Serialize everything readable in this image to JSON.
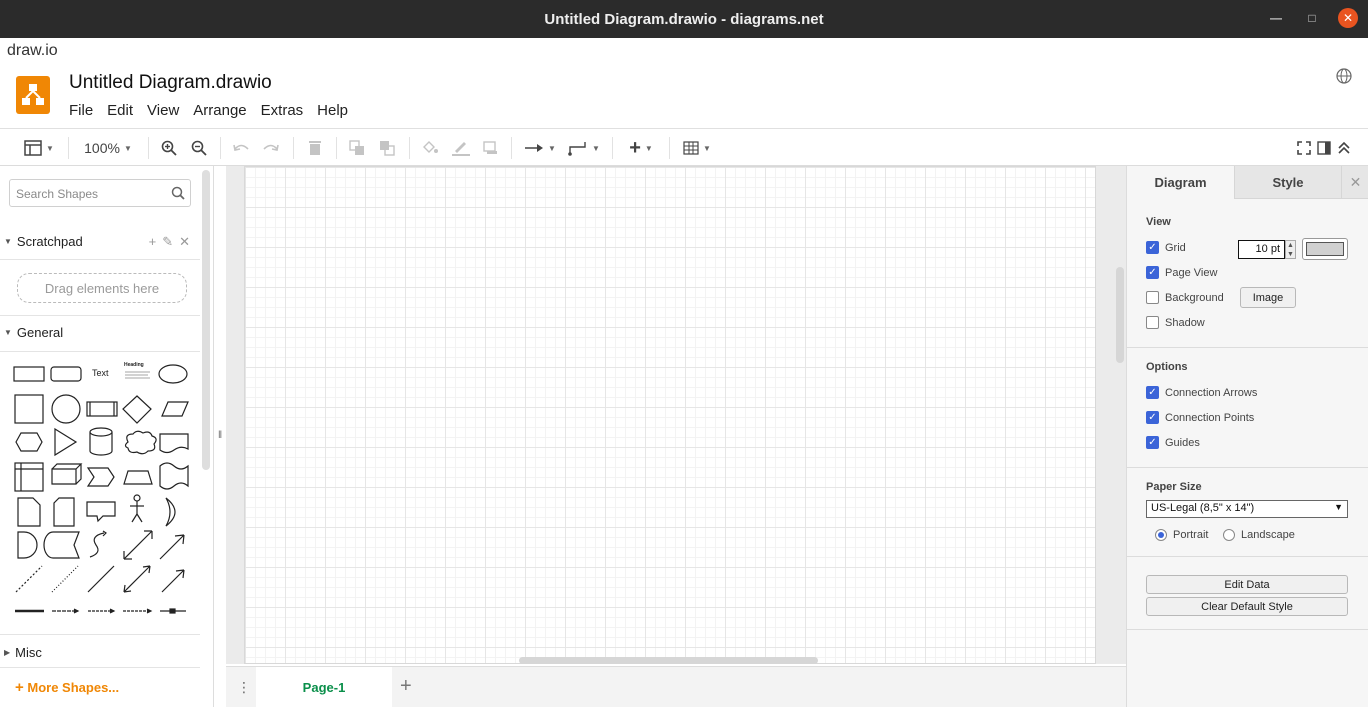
{
  "window": {
    "title": "Untitled Diagram.drawio - diagrams.net"
  },
  "app": {
    "name": "draw.io"
  },
  "header": {
    "doc_title": "Untitled Diagram.drawio",
    "menu": [
      "File",
      "Edit",
      "View",
      "Arrange",
      "Extras",
      "Help"
    ]
  },
  "toolbar": {
    "zoom": "100%"
  },
  "sidebar": {
    "search_placeholder": "Search Shapes",
    "scratchpad_label": "Scratchpad",
    "dropzone_text": "Drag elements here",
    "general_label": "General",
    "misc_label": "Misc",
    "more_shapes": "More Shapes...",
    "shape_text_label": "Text",
    "shape_heading_label": "Heading"
  },
  "pagebar": {
    "page_tab": "Page-1"
  },
  "panel": {
    "tabs": [
      "Diagram",
      "Style"
    ],
    "view_title": "View",
    "grid_label": "Grid",
    "grid_size": "10 pt",
    "grid_color": "#d0d0d0",
    "page_view_label": "Page View",
    "background_label": "Background",
    "image_button": "Image",
    "shadow_label": "Shadow",
    "options_title": "Options",
    "connection_arrows": "Connection Arrows",
    "connection_points": "Connection Points",
    "guides": "Guides",
    "paper_size_title": "Paper Size",
    "paper_size_value": "US-Legal (8,5\" x 14\")",
    "portrait": "Portrait",
    "landscape": "Landscape",
    "edit_data": "Edit Data",
    "clear_default_style": "Clear Default Style"
  },
  "colors": {
    "accent": "#f08705",
    "checkbox": "#3b64d8",
    "page_tab": "#0a8f4a"
  }
}
